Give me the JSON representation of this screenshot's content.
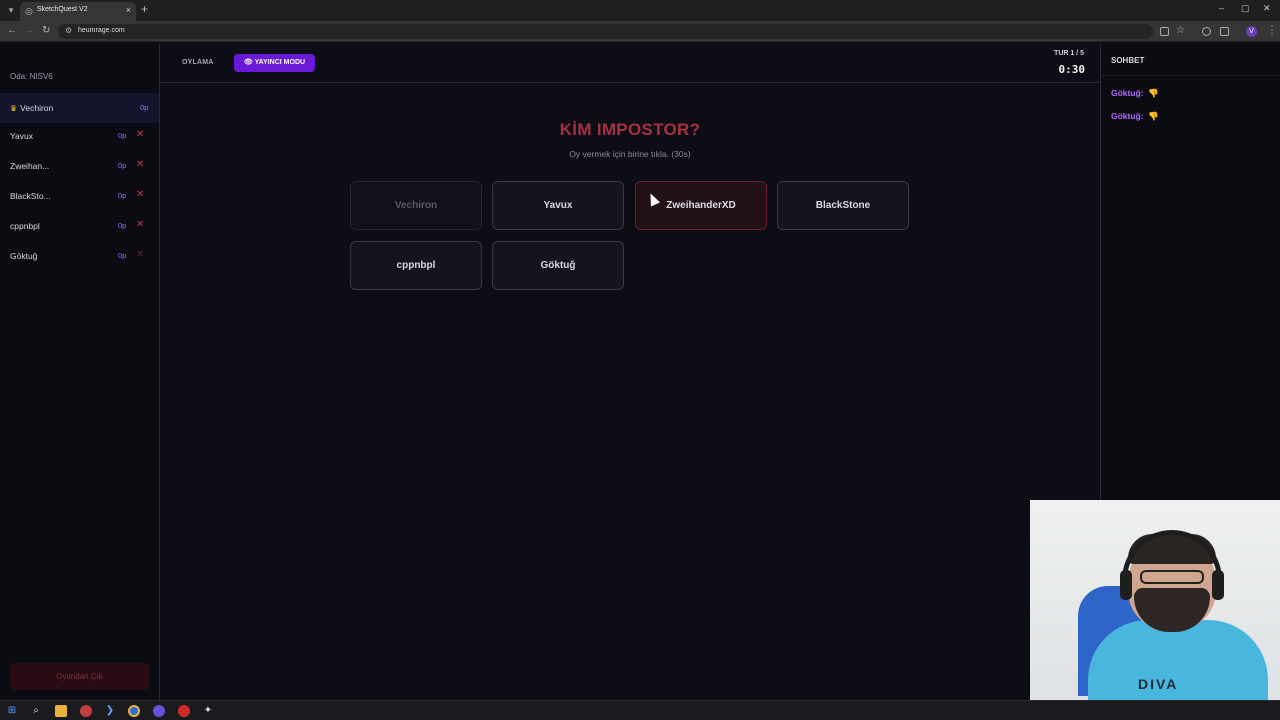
{
  "browser": {
    "tab_title": "SketchQuest V2",
    "url": "heumrage.com",
    "new_tab": "+",
    "tab_close": "×",
    "win_min": "–",
    "win_max": "▢",
    "win_close": "✕"
  },
  "sidebar": {
    "room_code": "Oda: NISV6",
    "players": [
      {
        "name": "Vechiron",
        "score": "0p",
        "host": true
      },
      {
        "name": "Yavux",
        "score": "0p",
        "kick": "✕"
      },
      {
        "name": "Zweihan...",
        "score": "0p",
        "kick": "✕"
      },
      {
        "name": "BlackSto...",
        "score": "0p",
        "kick": "✕"
      },
      {
        "name": "cppnbpl",
        "score": "0p",
        "kick": "✕"
      },
      {
        "name": "Göktuğ",
        "score": "0p",
        "kick": "✕"
      }
    ],
    "leave_label": "Oyundan Çık"
  },
  "topbar": {
    "phase_label": "OYLAMA",
    "streamer_label": "YAYINCI MODU",
    "streamer_icon": "eye-icon",
    "round_label": "TUR 1 / 5",
    "timer": "0:30"
  },
  "vote": {
    "title": "KİM IMPOSTOR?",
    "subtitle": "Oy vermek için birine tıkla. (30s)",
    "candidates": [
      {
        "name": "Vechiron",
        "state": "disabled"
      },
      {
        "name": "Yavux",
        "state": "normal"
      },
      {
        "name": "ZweihanderXD",
        "state": "hover"
      },
      {
        "name": "BlackStone",
        "state": "normal"
      },
      {
        "name": "cppnbpl",
        "state": "normal"
      },
      {
        "name": "Göktuğ",
        "state": "normal"
      }
    ]
  },
  "chat": {
    "title": "SOHBET",
    "messages": [
      {
        "user": "Göktuğ:",
        "emoji": "👎"
      },
      {
        "user": "Göktuğ:",
        "emoji": "👎"
      }
    ]
  },
  "colors": {
    "accent_purple": "#6a1ad6",
    "title_red": "#a8303f",
    "score_purple": "#9b6cff",
    "chat_user": "#b06bff",
    "crown_gold": "#f2c231"
  },
  "webcam": {
    "shirt_print": "DIVA"
  }
}
